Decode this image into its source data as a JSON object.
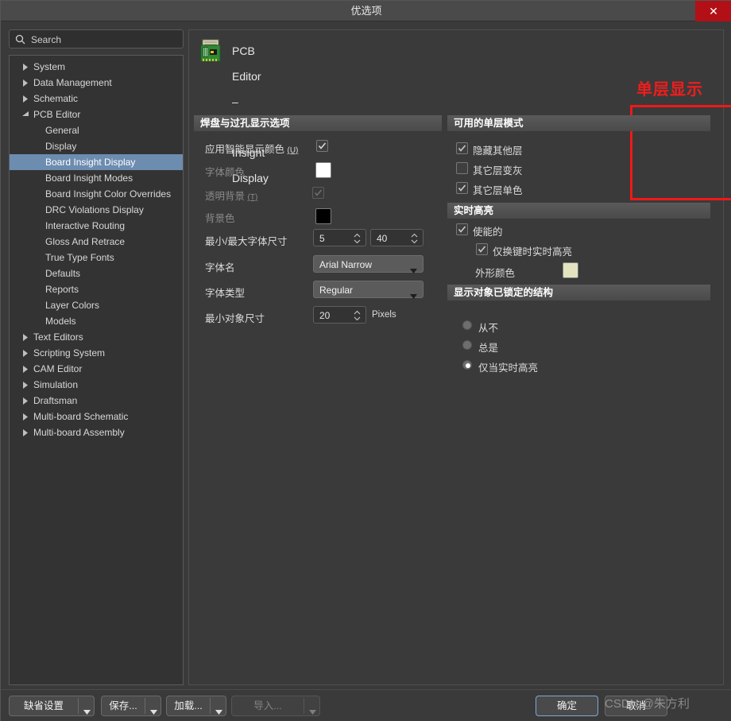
{
  "window": {
    "title": "优选项",
    "close_label": "✕"
  },
  "search": {
    "placeholder": "Search",
    "icon": "search-icon"
  },
  "tree": {
    "items": [
      {
        "label": "System",
        "depth": 0,
        "expandable": true,
        "expanded": false,
        "selected": false
      },
      {
        "label": "Data Management",
        "depth": 0,
        "expandable": true,
        "expanded": false,
        "selected": false
      },
      {
        "label": "Schematic",
        "depth": 0,
        "expandable": true,
        "expanded": false,
        "selected": false
      },
      {
        "label": "PCB Editor",
        "depth": 0,
        "expandable": true,
        "expanded": true,
        "selected": false
      },
      {
        "label": "General",
        "depth": 1,
        "expandable": false,
        "expanded": false,
        "selected": false
      },
      {
        "label": "Display",
        "depth": 1,
        "expandable": false,
        "expanded": false,
        "selected": false
      },
      {
        "label": "Board Insight Display",
        "depth": 1,
        "expandable": false,
        "expanded": false,
        "selected": true
      },
      {
        "label": "Board Insight Modes",
        "depth": 1,
        "expandable": false,
        "expanded": false,
        "selected": false
      },
      {
        "label": "Board Insight Color Overrides",
        "depth": 1,
        "expandable": false,
        "expanded": false,
        "selected": false
      },
      {
        "label": "DRC Violations Display",
        "depth": 1,
        "expandable": false,
        "expanded": false,
        "selected": false
      },
      {
        "label": "Interactive Routing",
        "depth": 1,
        "expandable": false,
        "expanded": false,
        "selected": false
      },
      {
        "label": "Gloss And Retrace",
        "depth": 1,
        "expandable": false,
        "expanded": false,
        "selected": false
      },
      {
        "label": "True Type Fonts",
        "depth": 1,
        "expandable": false,
        "expanded": false,
        "selected": false
      },
      {
        "label": "Defaults",
        "depth": 1,
        "expandable": false,
        "expanded": false,
        "selected": false
      },
      {
        "label": "Reports",
        "depth": 1,
        "expandable": false,
        "expanded": false,
        "selected": false
      },
      {
        "label": "Layer Colors",
        "depth": 1,
        "expandable": false,
        "expanded": false,
        "selected": false
      },
      {
        "label": "Models",
        "depth": 1,
        "expandable": false,
        "expanded": false,
        "selected": false
      },
      {
        "label": "Text Editors",
        "depth": 0,
        "expandable": true,
        "expanded": false,
        "selected": false
      },
      {
        "label": "Scripting System",
        "depth": 0,
        "expandable": true,
        "expanded": false,
        "selected": false
      },
      {
        "label": "CAM Editor",
        "depth": 0,
        "expandable": true,
        "expanded": false,
        "selected": false
      },
      {
        "label": "Simulation",
        "depth": 0,
        "expandable": true,
        "expanded": false,
        "selected": false
      },
      {
        "label": "Draftsman",
        "depth": 0,
        "expandable": true,
        "expanded": false,
        "selected": false
      },
      {
        "label": "Multi-board Schematic",
        "depth": 0,
        "expandable": true,
        "expanded": false,
        "selected": false
      },
      {
        "label": "Multi-board Assembly",
        "depth": 0,
        "expandable": true,
        "expanded": false,
        "selected": false
      }
    ]
  },
  "page": {
    "icon": "pcb-board-icon",
    "title": "PCB Editor – Board Insight Display"
  },
  "annotation": {
    "title": "单层显示",
    "color": "#ef1d1d"
  },
  "pad_via": {
    "header": "焊盘与过孔显示选项",
    "apply_smart_color": {
      "label": "应用智能显示颜色",
      "hotkey": "(U)",
      "checked": true,
      "enabled": true
    },
    "font_color": {
      "label": "字体颜色",
      "value": "#ffffff",
      "enabled": false
    },
    "transparent_bg": {
      "label": "透明背景",
      "hotkey": "(T)",
      "checked": true,
      "enabled": false
    },
    "background_color": {
      "label": "背景色",
      "value": "#000000",
      "enabled": false
    },
    "min_max_font": {
      "label": "最小/最大字体尺寸",
      "min": "5",
      "max": "40"
    },
    "font_name": {
      "label": "字体名",
      "value": "Arial Narrow"
    },
    "font_style": {
      "label": "字体类型",
      "value": "Regular"
    },
    "min_object_size": {
      "label": "最小对象尺寸",
      "value": "20",
      "unit": "Pixels"
    }
  },
  "single_layer": {
    "header": "可用的单层模式",
    "options": [
      {
        "label": "隐藏其他层",
        "checked": true
      },
      {
        "label": "其它层变灰",
        "checked": false
      },
      {
        "label": "其它层单色",
        "checked": true
      }
    ]
  },
  "live_highlight": {
    "header": "实时高亮",
    "enabled": {
      "label": "使能的",
      "checked": true
    },
    "shift_only": {
      "label": "仅换键时实时高亮",
      "checked": true
    },
    "outline_color": {
      "label": "外形颜色",
      "value": "#e4e4c0"
    }
  },
  "locked_objects": {
    "header": "显示对象已锁定的结构",
    "options": [
      {
        "label": "从不",
        "selected": false
      },
      {
        "label": "总是",
        "selected": false
      },
      {
        "label": "仅当实时高亮",
        "selected": true
      }
    ]
  },
  "footer": {
    "defaults": {
      "label": "缺省设置",
      "enabled": true
    },
    "save": {
      "label": "保存...",
      "enabled": true
    },
    "load": {
      "label": "加载...",
      "enabled": true
    },
    "import": {
      "label": "导入...",
      "enabled": false
    },
    "ok": {
      "label": "确定"
    },
    "cancel": {
      "label": "取消"
    }
  },
  "watermark": {
    "text": "CSDN @朱方利"
  }
}
